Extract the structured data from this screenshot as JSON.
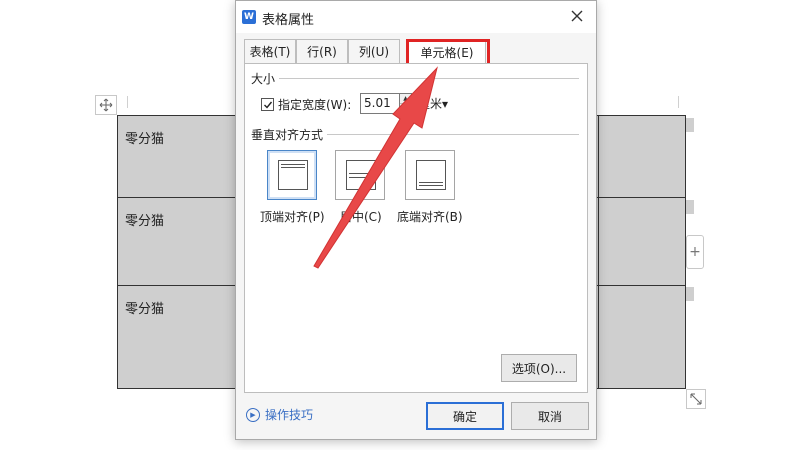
{
  "document": {
    "cells": [
      "零分猫",
      "零分猫",
      "零分猫"
    ],
    "add_row_icon": "plus-icon"
  },
  "dialog": {
    "title": "表格属性",
    "app_icon": "wps-writer-icon",
    "app_icon_text": "W",
    "close_icon": "close-icon",
    "tabs": [
      {
        "label": "表格(T)",
        "active": false
      },
      {
        "label": "行(R)",
        "active": false
      },
      {
        "label": "列(U)",
        "active": false
      },
      {
        "label": "单元格(E)",
        "active": true
      }
    ],
    "size_group": {
      "title": "大小",
      "width_checkbox_checked": true,
      "width_label": "指定宽度(W):",
      "width_value": "5.01",
      "unit": "厘米▾"
    },
    "valign_group": {
      "title": "垂直对齐方式",
      "options": [
        {
          "label": "顶端对齐(P)",
          "selected": true
        },
        {
          "label": "居中(C)",
          "selected": false
        },
        {
          "label": "底端对齐(B)",
          "selected": false
        }
      ]
    },
    "options_button": "选项(O)...",
    "tips_link": "操作技巧",
    "ok_button": "确定",
    "cancel_button": "取消"
  },
  "annotation": {
    "highlight_color": "#e02424",
    "arrow_color": "#e84848"
  }
}
